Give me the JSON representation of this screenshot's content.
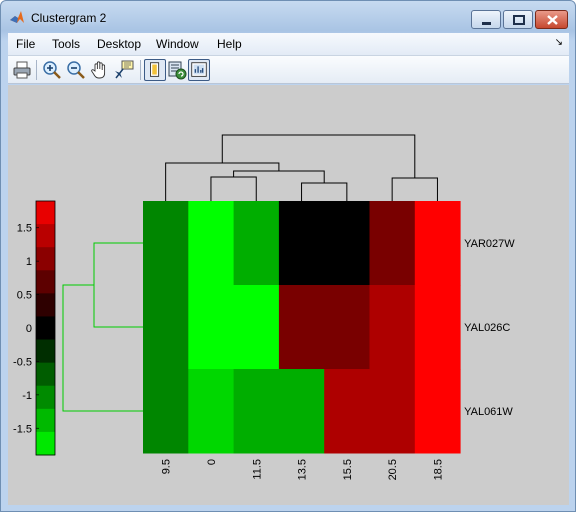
{
  "window": {
    "title": "Clustergram 2"
  },
  "menu": {
    "items": [
      "File",
      "Tools",
      "Desktop",
      "Window",
      "Help"
    ],
    "overflow_glyph": "↘"
  },
  "toolbar": {
    "buttons": [
      "print-icon",
      "zoom-in-icon",
      "zoom-out-icon",
      "pan-icon",
      "data-cursor-icon",
      "colorbar-icon",
      "legend-icon",
      "plot-tools-icon"
    ]
  },
  "colors": {
    "figure_bg": "#cccccc",
    "dendrogram_col": "#000000",
    "dendrogram_row": "#00cc00",
    "low": "#00ff00",
    "mid": "#000000",
    "high": "#ff0000"
  },
  "colorbar": {
    "tick_labels": [
      "1.5",
      "1",
      "0.5",
      "0",
      "-0.5",
      "-1",
      "-1.5"
    ],
    "tick_values": [
      1.5,
      1,
      0.5,
      0,
      -0.5,
      -1,
      -1.5
    ],
    "range": [
      -1.9,
      1.9
    ],
    "levels": 11
  },
  "chart_data": {
    "type": "heatmap",
    "columns": [
      "9.5",
      "0",
      "11.5",
      "13.5",
      "15.5",
      "20.5",
      "18.5"
    ],
    "rows": [
      "YAR027W",
      "YAL026C",
      "YAL061W"
    ],
    "values": [
      [
        -1.0,
        -1.9,
        -1.3,
        0.0,
        0.0,
        0.9,
        1.9
      ],
      [
        -1.0,
        -1.9,
        -1.9,
        0.9,
        0.9,
        1.3,
        1.9
      ],
      [
        -1.0,
        -1.6,
        -1.3,
        -1.3,
        1.3,
        1.3,
        1.9
      ]
    ],
    "color_range": [
      -1.9,
      1.9
    ],
    "colormap": [
      "#00ff00",
      "#000000",
      "#ff0000"
    ]
  }
}
